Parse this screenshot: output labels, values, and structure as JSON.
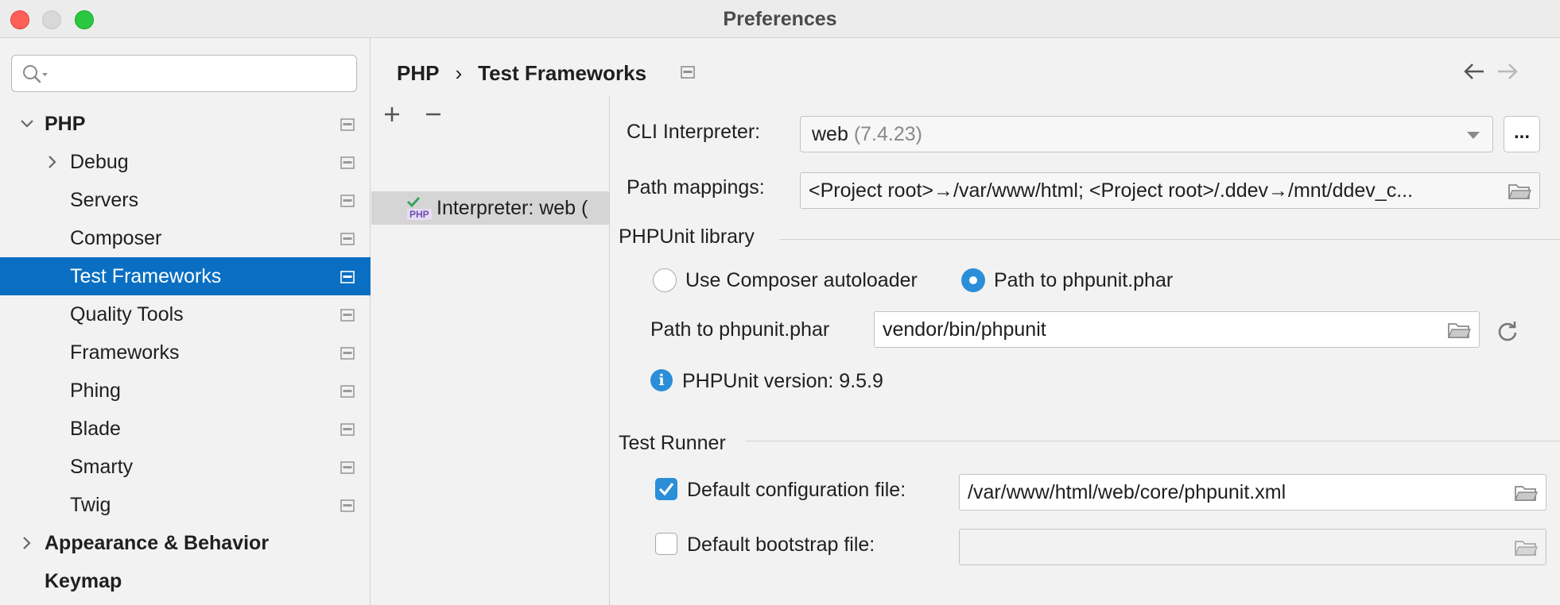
{
  "window": {
    "title": "Preferences"
  },
  "sidebar": {
    "search": {
      "placeholder": "",
      "value": ""
    },
    "items": [
      {
        "label": "PHP",
        "level": 0,
        "expanded": true,
        "bold": true
      },
      {
        "label": "Debug",
        "level": 1,
        "expanded": false
      },
      {
        "label": "Servers",
        "level": 1
      },
      {
        "label": "Composer",
        "level": 1
      },
      {
        "label": "Test Frameworks",
        "level": 1,
        "selected": true
      },
      {
        "label": "Quality Tools",
        "level": 1
      },
      {
        "label": "Frameworks",
        "level": 1
      },
      {
        "label": "Phing",
        "level": 1
      },
      {
        "label": "Blade",
        "level": 1
      },
      {
        "label": "Smarty",
        "level": 1
      },
      {
        "label": "Twig",
        "level": 1
      },
      {
        "label": "Appearance & Behavior",
        "level": 0,
        "expanded": false,
        "bold": true
      },
      {
        "label": "Keymap",
        "level": 0,
        "bold": true
      }
    ]
  },
  "header": {
    "breadcrumb_parent": "PHP",
    "breadcrumb_separator": "›",
    "breadcrumb_current": "Test Frameworks"
  },
  "configurations": {
    "add_label": "+",
    "remove_label": "−",
    "items": [
      {
        "label": "Interpreter: web (",
        "badge": "PHP"
      }
    ]
  },
  "settings": {
    "cli_interpreter_label": "CLI Interpreter:",
    "cli_interpreter_name": "web",
    "cli_interpreter_version": " (7.4.23)",
    "ellipsis_label": "...",
    "path_mappings_label": "Path mappings:",
    "path_mappings_value": "<Project root>→/var/www/html; <Project root>/.ddev→/mnt/ddev_c...",
    "phpunit_library": {
      "title": "PHPUnit library",
      "option_autoloader": "Use Composer autoloader",
      "option_phar": "Path to phpunit.phar",
      "selected_option": "phar",
      "phar_path_label": "Path to phpunit.phar",
      "phar_path_value": "vendor/bin/phpunit",
      "version_text": "PHPUnit version: 9.5.9"
    },
    "test_runner": {
      "title": "Test Runner",
      "default_config_label": "Default configuration file:",
      "default_config_checked": true,
      "default_config_value": "/var/www/html/web/core/phpunit.xml",
      "default_bootstrap_label": "Default bootstrap file:",
      "default_bootstrap_checked": false,
      "default_bootstrap_value": ""
    }
  },
  "colors": {
    "selection": "#0a6fc2",
    "accent": "#2b8ed8",
    "close": "#fe5f57",
    "maximize": "#29c840"
  }
}
